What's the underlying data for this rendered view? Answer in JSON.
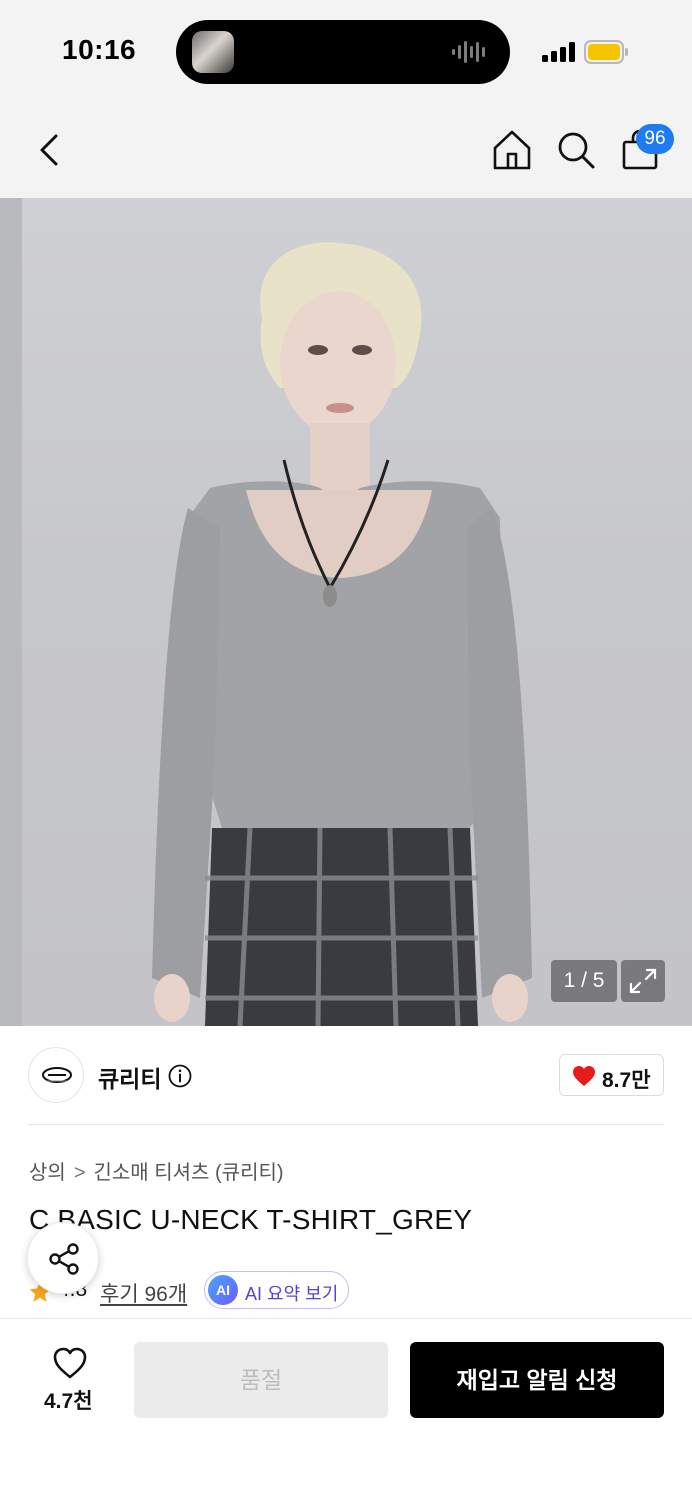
{
  "status_bar": {
    "time": "10:16"
  },
  "header": {
    "cart_count": "96"
  },
  "gallery": {
    "counter": "1 / 5",
    "current_index": 1,
    "total": 5
  },
  "brand": {
    "name": "큐리티",
    "likes": "8.7만"
  },
  "breadcrumb": [
    "상의",
    "긴소매 티셔츠 (큐리티)"
  ],
  "product": {
    "title": "C BASIC U-NECK T-SHIRT_GREY",
    "rating": "4.8",
    "reviews_link": "후기 96개",
    "ai_badge": "AI",
    "ai_summary_label": "AI 요약 보기"
  },
  "bottom_bar": {
    "wish_count": "4.7천",
    "soldout_label": "품절",
    "restock_label": "재입고 알림 신청"
  },
  "colors": {
    "accent_badge": "#1e7bf2",
    "like_heart": "#e81b1b",
    "star": "#f7a51c",
    "ai_text": "#5b3fd6",
    "restock_button": "#000000",
    "soldout_button": "#ebebeb"
  },
  "icons": [
    "back-chevron-icon",
    "home-icon",
    "search-icon",
    "cart-icon",
    "expand-icon",
    "info-icon",
    "heart-icon",
    "star-icon",
    "share-icon",
    "wish-heart-icon"
  ]
}
